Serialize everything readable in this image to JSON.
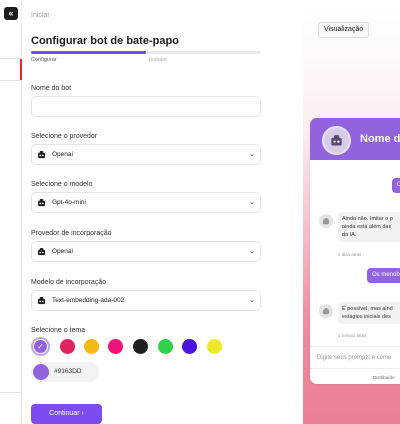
{
  "sidebar": {
    "collapse_label": "«"
  },
  "breadcrumb": "Iniciar",
  "page_title": "Configurar bot de bate-papo",
  "progress": {
    "value_percent": 50,
    "steps": [
      "Configurar",
      "Instalar"
    ]
  },
  "form": {
    "bot_name": {
      "label": "Nome do bot",
      "value": ""
    },
    "provider": {
      "label": "Selecione o provedor",
      "value": "Openai",
      "icon": "openai-icon"
    },
    "model": {
      "label": "Selecione o modelo",
      "value": "Gpt-4o-mini",
      "icon": "openai-icon"
    },
    "embedding_provider": {
      "label": "Provedor de incorporação",
      "value": "Openai",
      "icon": "openai-icon"
    },
    "embedding_model": {
      "label": "Modelo de incorporação",
      "value": "Text-embedding-ada-002",
      "icon": "openai-icon"
    },
    "theme": {
      "label": "Selecione o tema",
      "swatches": [
        "#9163DD",
        "#E2245E",
        "#F5B915",
        "#F0137A",
        "#1F1F1F",
        "#2FD24A",
        "#4A13E0",
        "#EDE82A"
      ],
      "selected_index": 0,
      "custom_hex": "#9163DD"
    }
  },
  "continue_label": "Continuar ›",
  "preview": {
    "button_label": "Visualização",
    "bot_title": "Nome do bot",
    "accent": "#9163DD",
    "messages": [
      {
        "role": "user",
        "text": "O"
      },
      {
        "role": "bot",
        "text": "Ainda não. Imitar o p ainda está além das da IA.",
        "lines": [
          "Ainda não. Imitar o p",
          "ainda está além das",
          "da IA."
        ],
        "time": "2 dias atrás"
      },
      {
        "role": "user",
        "text": "Os menobo"
      },
      {
        "role": "bot",
        "text": "É possível, mas aind estágios iniciais des",
        "lines": [
          "É possível, mas aind",
          "estágios iniciais des"
        ],
        "time": "1 minuto atrás"
      }
    ],
    "input_placeholder": "Digite seus prompts e come",
    "powered_by": "Distribuído"
  }
}
